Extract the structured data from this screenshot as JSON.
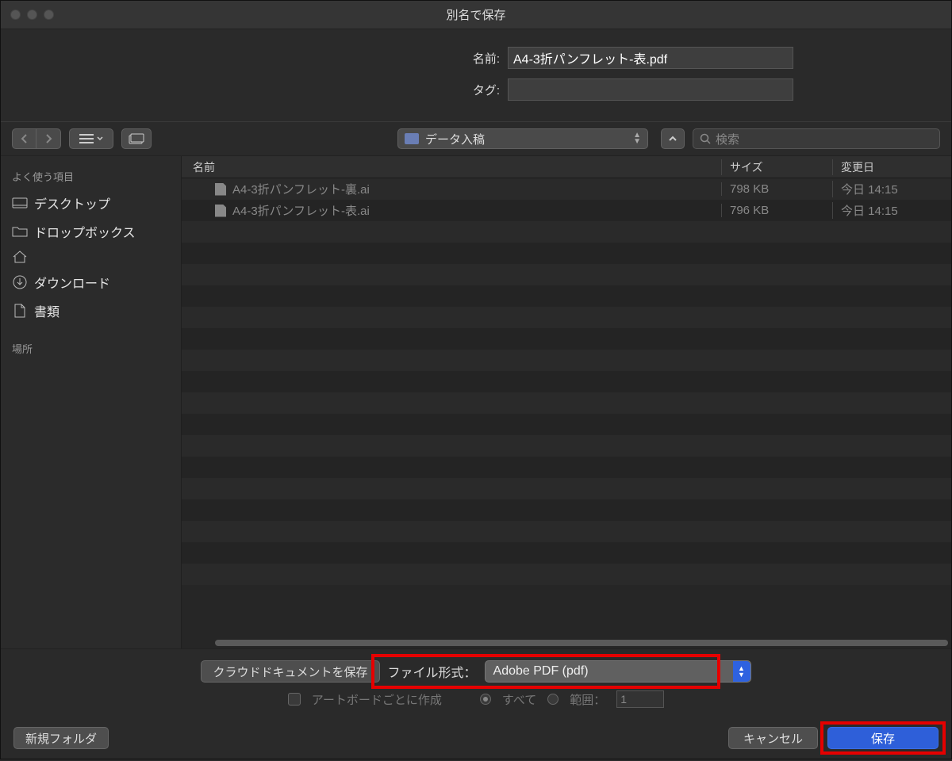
{
  "window": {
    "title": "別名で保存"
  },
  "form": {
    "name_label": "名前:",
    "name_value": "A4-3折パンフレット-表.pdf",
    "tags_label": "タグ:",
    "tags_value": ""
  },
  "toolbar": {
    "location": "データ入稿",
    "search_placeholder": "検索"
  },
  "sidebar": {
    "favorites_heading": "よく使う項目",
    "items": [
      {
        "label": "デスクトップ",
        "icon": "desktop"
      },
      {
        "label": "ドロップボックス",
        "icon": "folder"
      },
      {
        "label": "",
        "icon": "home"
      },
      {
        "label": "ダウンロード",
        "icon": "download"
      },
      {
        "label": "書類",
        "icon": "document"
      }
    ],
    "locations_heading": "場所"
  },
  "list": {
    "col_name": "名前",
    "col_size": "サイズ",
    "col_date": "変更日",
    "rows": [
      {
        "name": "A4-3折パンフレット-裏.ai",
        "size": "798 KB",
        "date": "今日 14:15"
      },
      {
        "name": "A4-3折パンフレット-表.ai",
        "size": "796 KB",
        "date": "今日 14:15"
      }
    ]
  },
  "options": {
    "cloud_button": "クラウドドキュメントを保存",
    "format_label": "ファイル形式：",
    "format_value": "Adobe PDF (pdf)",
    "artboard_checkbox": "アートボードごとに作成",
    "all_label": "すべて",
    "range_label": "範囲：",
    "range_value": "1"
  },
  "footer": {
    "new_folder": "新規フォルダ",
    "cancel": "キャンセル",
    "save": "保存"
  }
}
